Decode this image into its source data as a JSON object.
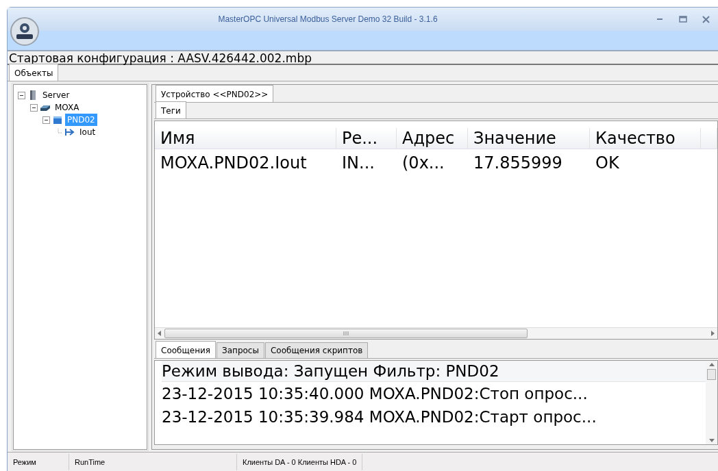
{
  "window": {
    "title": "MasterOPC Universal Modbus Server Demo 32 Build - 3.1.6"
  },
  "config_line": "Стартовая конфигурация : AASV.426442.002.mbp",
  "main_tabs": [
    {
      "label": "Объекты",
      "selected": true
    }
  ],
  "tree": [
    {
      "label": "Server",
      "kind": "server",
      "expanded": true,
      "selected": false,
      "children": [
        {
          "label": "MOXA",
          "kind": "channel",
          "expanded": true,
          "selected": false,
          "children": [
            {
              "label": "PND02",
              "kind": "device",
              "expanded": true,
              "selected": true,
              "children": [
                {
                  "label": "Iout",
                  "kind": "tag",
                  "selected": false
                }
              ]
            }
          ]
        }
      ]
    }
  ],
  "device_tabs": [
    {
      "label": "Устройство <<PND02>>",
      "selected": true
    }
  ],
  "inner_tabs": [
    {
      "label": "Теги",
      "selected": true
    }
  ],
  "table": {
    "columns": [
      "Имя",
      "Ре...",
      "Адрес",
      "Значение",
      "Качество"
    ],
    "rows": [
      [
        "MOXA.PND02.Iout",
        "IN...",
        "(0x...",
        "17.855999",
        "OK"
      ]
    ]
  },
  "log_tabs": [
    {
      "label": "Сообщения",
      "selected": true
    },
    {
      "label": "Запросы",
      "selected": false
    },
    {
      "label": "Сообщения скриптов",
      "selected": false
    }
  ],
  "log": {
    "header": "Режим вывода: Запущен Фильтр: PND02",
    "lines": [
      "23-12-2015 10:35:40.000 MOXA.PND02:Стоп опрос...",
      "23-12-2015 10:35:39.984 MOXA.PND02:Старт опрос..."
    ]
  },
  "status_bar": [
    "Режим",
    "RunTime",
    "Клиенты DA - 0 Клиенты HDA - 0"
  ]
}
